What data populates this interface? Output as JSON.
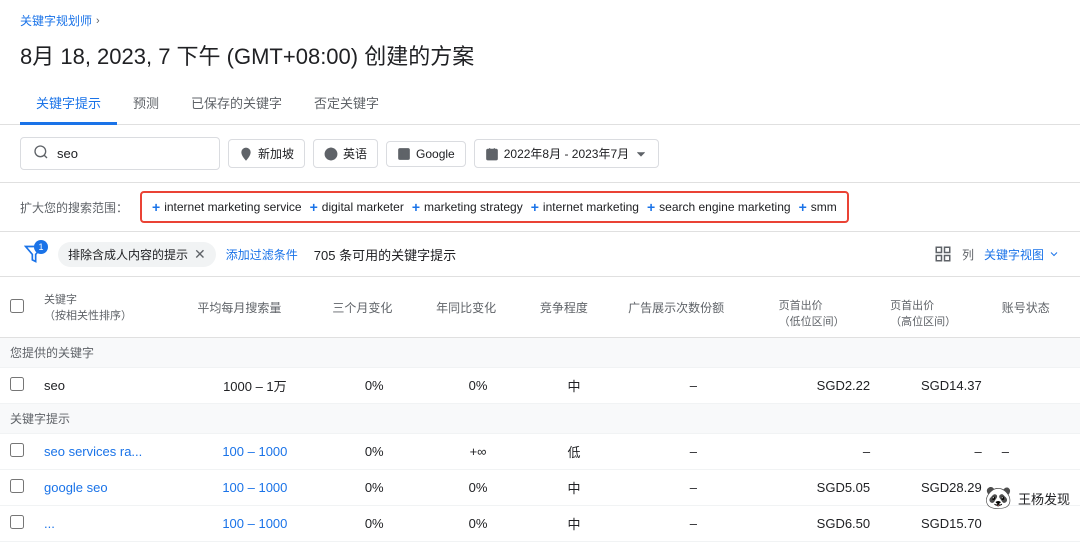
{
  "breadcrumb": {
    "link_text": "关键字规划师",
    "separator": "›"
  },
  "page_title": "8月 18, 2023, 7 下午 (GMT+08:00) 创建的方案",
  "tabs": [
    {
      "label": "关键字提示",
      "active": true
    },
    {
      "label": "预测",
      "active": false
    },
    {
      "label": "已保存的关键字",
      "active": false
    },
    {
      "label": "否定关键字",
      "active": false
    }
  ],
  "search_bar": {
    "query": "seo",
    "location": "新加坡",
    "language": "英语",
    "engine": "Google",
    "date_range": "2022年8月 - 2023年7月"
  },
  "expand_section": {
    "label": "扩大您的搜索范围：",
    "chips": [
      "internet marketing service",
      "digital marketer",
      "marketing strategy",
      "internet marketing",
      "search engine marketing",
      "smm"
    ]
  },
  "table_controls": {
    "filter_badge": "1",
    "filter_tag_label": "排除含成人内容的提示",
    "add_filter_label": "添加过滤条件",
    "result_count": "705 条可用的关键字提示",
    "view_label": "列",
    "keyword_view_label": "关键字视图"
  },
  "table": {
    "headers": [
      "",
      "关键字\n（按相关性排序）",
      "平均每月搜索量",
      "三个月变化",
      "年同比变化",
      "竞争程度",
      "广告展示次数份额",
      "页首出价\n（低位区间）",
      "页首出价\n（高位区间）",
      "账号状态"
    ],
    "section_provided": "您提供的关键字",
    "section_suggestions": "关键字提示",
    "rows_provided": [
      {
        "keyword": "seo",
        "monthly_searches": "1000 – 1万",
        "three_month": "0%",
        "yoy": "0%",
        "competition": "中",
        "impressions": "–",
        "low_bid": "SGD2.22",
        "high_bid": "SGD14.37",
        "account_status": ""
      }
    ],
    "rows_suggestions": [
      {
        "keyword": "seo services ra...",
        "monthly_searches": "100 – 1000",
        "three_month": "0%",
        "yoy": "+∞",
        "competition": "低",
        "impressions": "–",
        "low_bid": "–",
        "high_bid": "–",
        "account_status": "–"
      },
      {
        "keyword": "google seo",
        "monthly_searches": "100 – 1000",
        "three_month": "0%",
        "yoy": "0%",
        "competition": "中",
        "impressions": "–",
        "low_bid": "SGD5.05",
        "high_bid": "SGD28.29",
        "account_status": ""
      },
      {
        "keyword": "...",
        "monthly_searches": "100 – 1000",
        "three_month": "0%",
        "yoy": "0%",
        "competition": "中",
        "impressions": "–",
        "low_bid": "SGD6.50",
        "high_bid": "SGD15.70",
        "account_status": ""
      }
    ]
  }
}
